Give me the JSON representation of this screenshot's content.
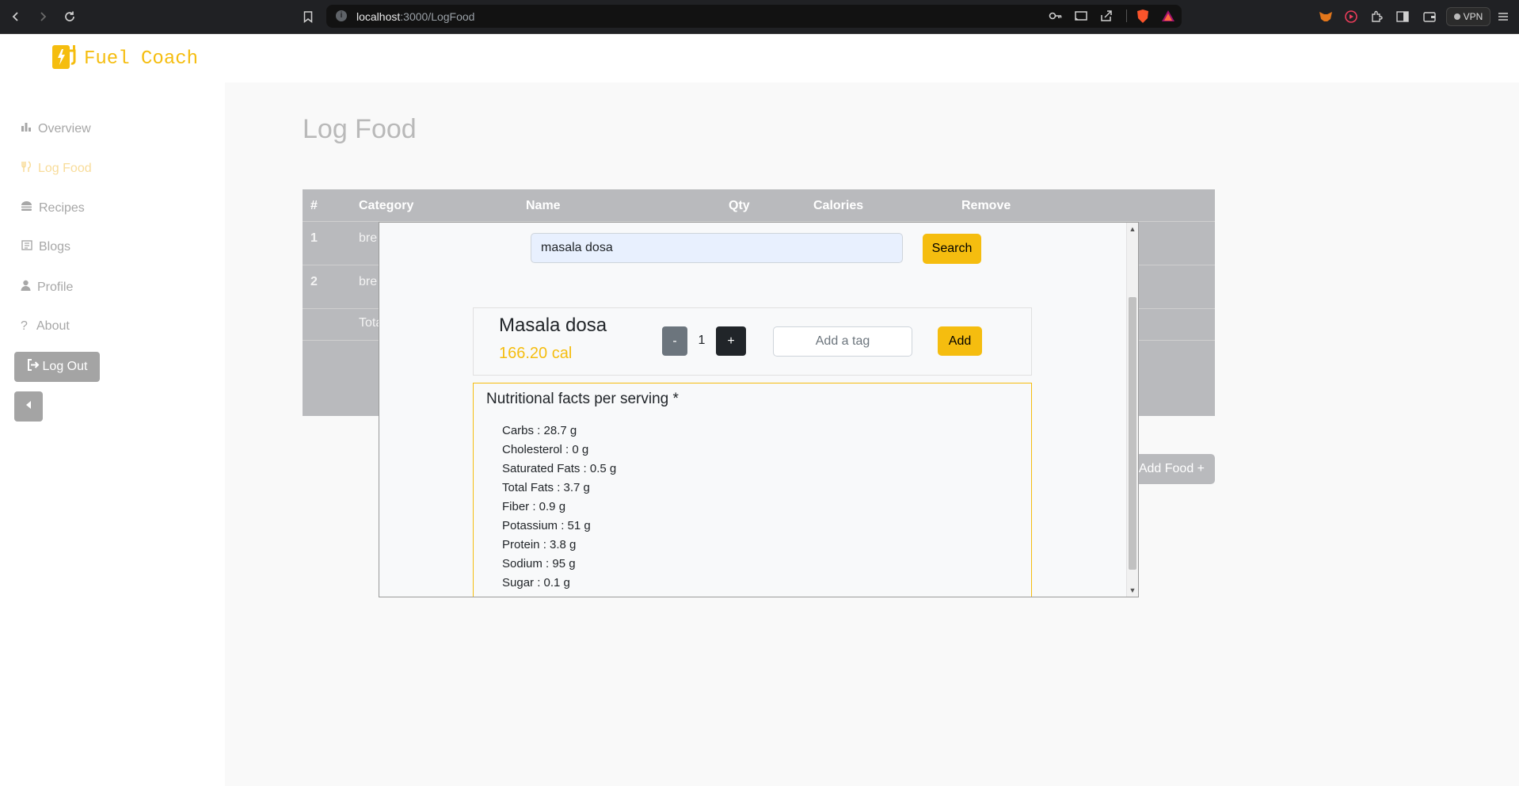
{
  "browser": {
    "url_host": "localhost",
    "url_path": ":3000/LogFood",
    "vpn_label": "VPN"
  },
  "brand": {
    "name": "Fuel Coach",
    "accent": "#f5bd0f"
  },
  "sidebar": {
    "items": [
      {
        "label": "Overview",
        "icon": "bar-chart-icon",
        "active": false
      },
      {
        "label": "Log Food",
        "icon": "utensils-icon",
        "active": true
      },
      {
        "label": "Recipes",
        "icon": "burger-icon",
        "active": false
      },
      {
        "label": "Blogs",
        "icon": "newspaper-icon",
        "active": false
      },
      {
        "label": "Profile",
        "icon": "user-icon",
        "active": false
      },
      {
        "label": "About",
        "icon": "question-icon",
        "active": false
      }
    ],
    "logout_label": "Log Out"
  },
  "page": {
    "title": "Log Food",
    "add_food_label": "Add Food +"
  },
  "table": {
    "headers": [
      "#",
      "Category",
      "Name",
      "Qty",
      "Calories",
      "Remove"
    ],
    "rows": [
      {
        "index": "1",
        "category": "bre"
      },
      {
        "index": "2",
        "category": "bre"
      }
    ],
    "total_label": "Tota"
  },
  "modal": {
    "search_value": "masala dosa",
    "search_label": "Search",
    "food": {
      "name": "Masala dosa",
      "calories": "166.20 cal",
      "minus_label": "-",
      "quantity": "1",
      "plus_label": "+",
      "tag_placeholder": "Add a tag",
      "add_label": "Add"
    },
    "nutrition": {
      "title": "Nutritional facts per serving *",
      "facts": [
        "Carbs : 28.7 g",
        "Cholesterol : 0 g",
        "Saturated Fats : 0.5 g",
        "Total Fats : 3.7 g",
        "Fiber : 0.9 g",
        "Potassium : 51 g",
        "Protein : 3.8 g",
        "Sodium : 95 g",
        "Sugar : 0.1 g"
      ]
    }
  }
}
